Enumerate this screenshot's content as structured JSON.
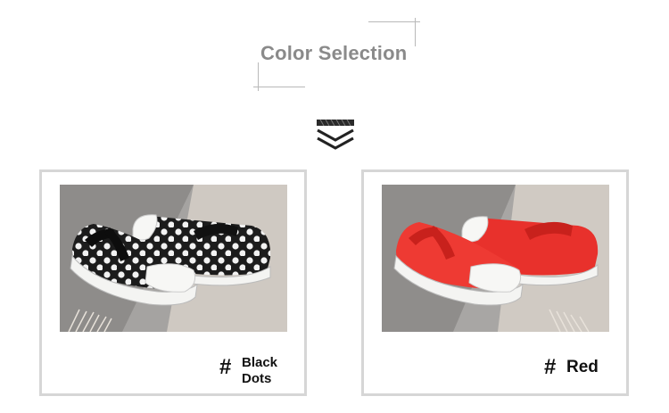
{
  "header": {
    "title": "Color Selection"
  },
  "colors": {
    "title_gray": "#8a8a8a",
    "frame_gray": "#d6d6d6",
    "shoe_red": "#e8312c",
    "shoe_black": "#1c1c1c"
  },
  "options": [
    {
      "hash": "#",
      "name_line1": "Black",
      "name_line2": "Dots"
    },
    {
      "hash": "#",
      "name": "Red"
    }
  ]
}
